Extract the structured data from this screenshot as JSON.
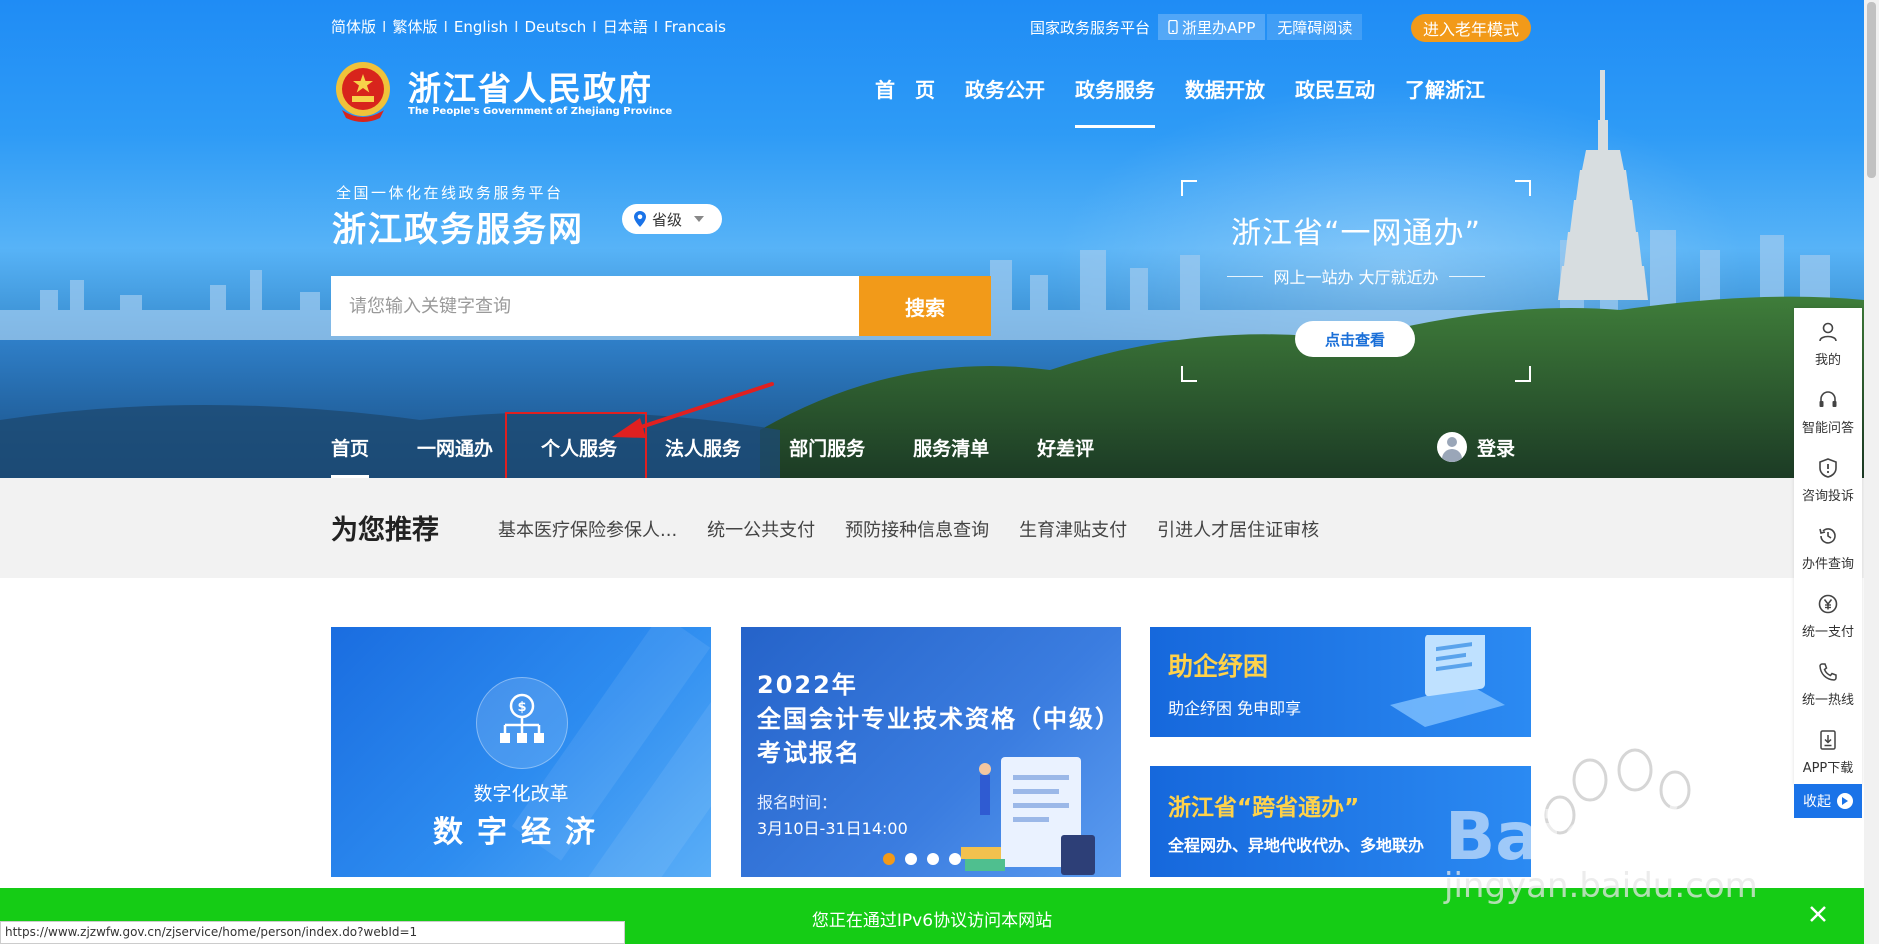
{
  "languages": [
    "简体版",
    "繁体版",
    "English",
    "Deutsch",
    "日本語",
    "Francais"
  ],
  "language_separator": "I",
  "util": {
    "platform": "国家政务服务平台",
    "app": "浙里办APP",
    "accessible": "无障碍阅读",
    "elder_mode": "进入老年模式"
  },
  "logo": {
    "title": "浙江省人民政府",
    "subtitle": "The People's Government of Zhejiang Province"
  },
  "main_nav": [
    "首　页",
    "政务公开",
    "政务服务",
    "数据开放",
    "政民互动",
    "了解浙江"
  ],
  "main_nav_active": "政务服务",
  "portal": {
    "subtitle": "全国一体化在线政务服务平台",
    "title": "浙江政务服务网",
    "location": "省级"
  },
  "search": {
    "placeholder": "请您输入关键字查询",
    "button": "搜索"
  },
  "promo": {
    "title": "浙江省“一网通办”",
    "subtitle": "网上一站办 大厅就近办",
    "button": "点击查看"
  },
  "sub_nav": [
    "首页",
    "一网通办",
    "个人服务",
    "法人服务",
    "部门服务",
    "服务清单",
    "好差评"
  ],
  "sub_nav_active": "首页",
  "login": "登录",
  "recommend": {
    "title": "为您推荐",
    "links": [
      "基本医疗保险参保人...",
      "统一公共支付",
      "预防接种信息查询",
      "生育津贴支付",
      "引进人才居住证审核"
    ]
  },
  "cards": {
    "card1": {
      "caption": "数字化改革",
      "headline": "数字经济"
    },
    "card2": {
      "line1": "2022年",
      "line2": "全国会计专业技术资格（中级）",
      "line3": "考试报名",
      "date_label": "报名时间：",
      "date_value": "3月10日-31日14:00"
    },
    "card3": {
      "title": "助企纾困",
      "subtitle": "助企纾困 免申即享"
    },
    "card4": {
      "title": "浙江省“跨省通办”",
      "subtitle": "全程网办、异地代收代办、多地联办"
    }
  },
  "side_toolbar": [
    {
      "label": "我的",
      "icon": "user-icon"
    },
    {
      "label": "智能问答",
      "icon": "headset-icon"
    },
    {
      "label": "咨询投诉",
      "icon": "shield-alert-icon"
    },
    {
      "label": "办件查询",
      "icon": "history-icon"
    },
    {
      "label": "统一支付",
      "icon": "yen-icon"
    },
    {
      "label": "统一热线",
      "icon": "phone-icon"
    },
    {
      "label": "APP下载",
      "icon": "download-icon"
    }
  ],
  "side_collapse": "收起",
  "notice": "您正在通过IPv6协议访问本网站",
  "status_url": "https://www.zjzwfw.gov.cn/zjservice/home/person/index.do?webId=1",
  "watermark": {
    "brand": "Baidu经验",
    "url": "jingyan.baidu.com"
  },
  "colors": {
    "primary": "#1a73e8",
    "accent": "#f29a19",
    "notice": "#15cc15",
    "highlight": "#e02020",
    "yellow": "#ffd24a"
  }
}
